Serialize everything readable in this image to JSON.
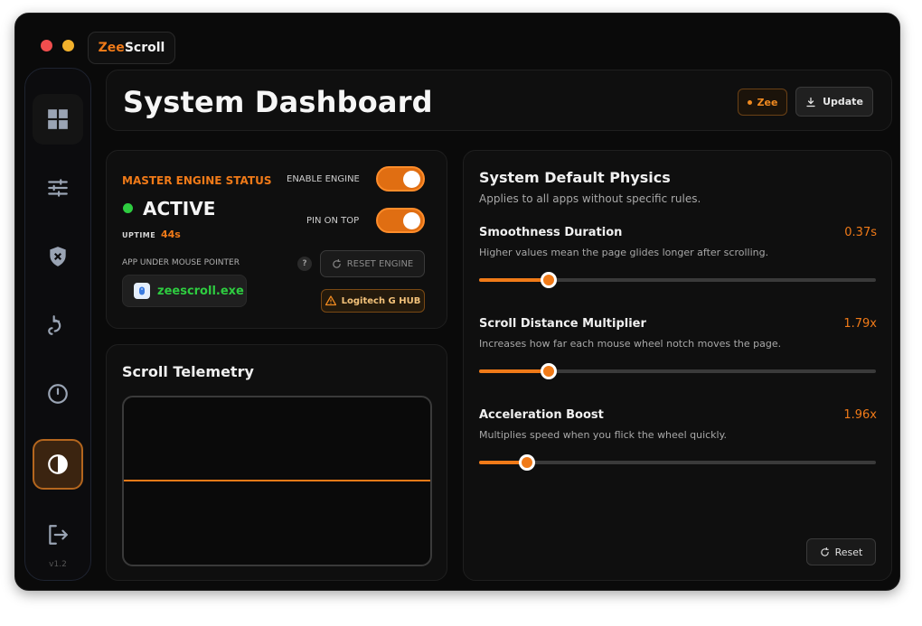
{
  "app": {
    "brand_prefix": "Zee",
    "brand_suffix": "Scroll",
    "version": "v1.2"
  },
  "sidebar": {
    "items": [
      {
        "icon": "dashboard-grid-icon",
        "active": false
      },
      {
        "icon": "sliders-icon",
        "active": false
      },
      {
        "icon": "shield-icon",
        "active": false
      },
      {
        "icon": "scroll-gesture-icon",
        "active": false
      },
      {
        "icon": "power-icon",
        "active": false
      },
      {
        "icon": "contrast-icon",
        "active": true
      },
      {
        "icon": "exit-icon",
        "active": false
      }
    ]
  },
  "header": {
    "title": "System Dashboard",
    "zee_label": "Zee",
    "update_label": "Update"
  },
  "status": {
    "master_label": "MASTER ENGINE STATUS",
    "state": "ACTIVE",
    "uptime_label": "UPTIME",
    "uptime_value": "44s",
    "app_label": "APP UNDER MOUSE POINTER",
    "app_name": "zeescroll.exe",
    "enable_engine_label": "ENABLE ENGINE",
    "enable_engine_on": true,
    "pin_on_top_label": "PIN ON TOP",
    "pin_on_top_on": true,
    "help_symbol": "?",
    "reset_engine_label": "RESET ENGINE",
    "warning_label": "Logitech G HUB"
  },
  "telemetry": {
    "title": "Scroll Telemetry"
  },
  "physics": {
    "title": "System Default Physics",
    "subtitle": "Applies to all apps without specific rules.",
    "settings": [
      {
        "name": "Smoothness Duration",
        "value": "0.37s",
        "desc": "Higher values mean the page glides longer after scrolling.",
        "fill_fraction": 0.175
      },
      {
        "name": "Scroll Distance Multiplier",
        "value": "1.79x",
        "desc": "Increases how far each mouse wheel notch moves the page.",
        "fill_fraction": 0.175
      },
      {
        "name": "Acceleration Boost",
        "value": "1.96x",
        "desc": "Multiplies speed when you flick the wheel quickly.",
        "fill_fraction": 0.12
      }
    ],
    "reset_label": "Reset"
  },
  "colors": {
    "accent": "#f07a18",
    "active_green": "#2ecc40",
    "background": "#0a0a0a",
    "panel": "#0f0f0f"
  }
}
